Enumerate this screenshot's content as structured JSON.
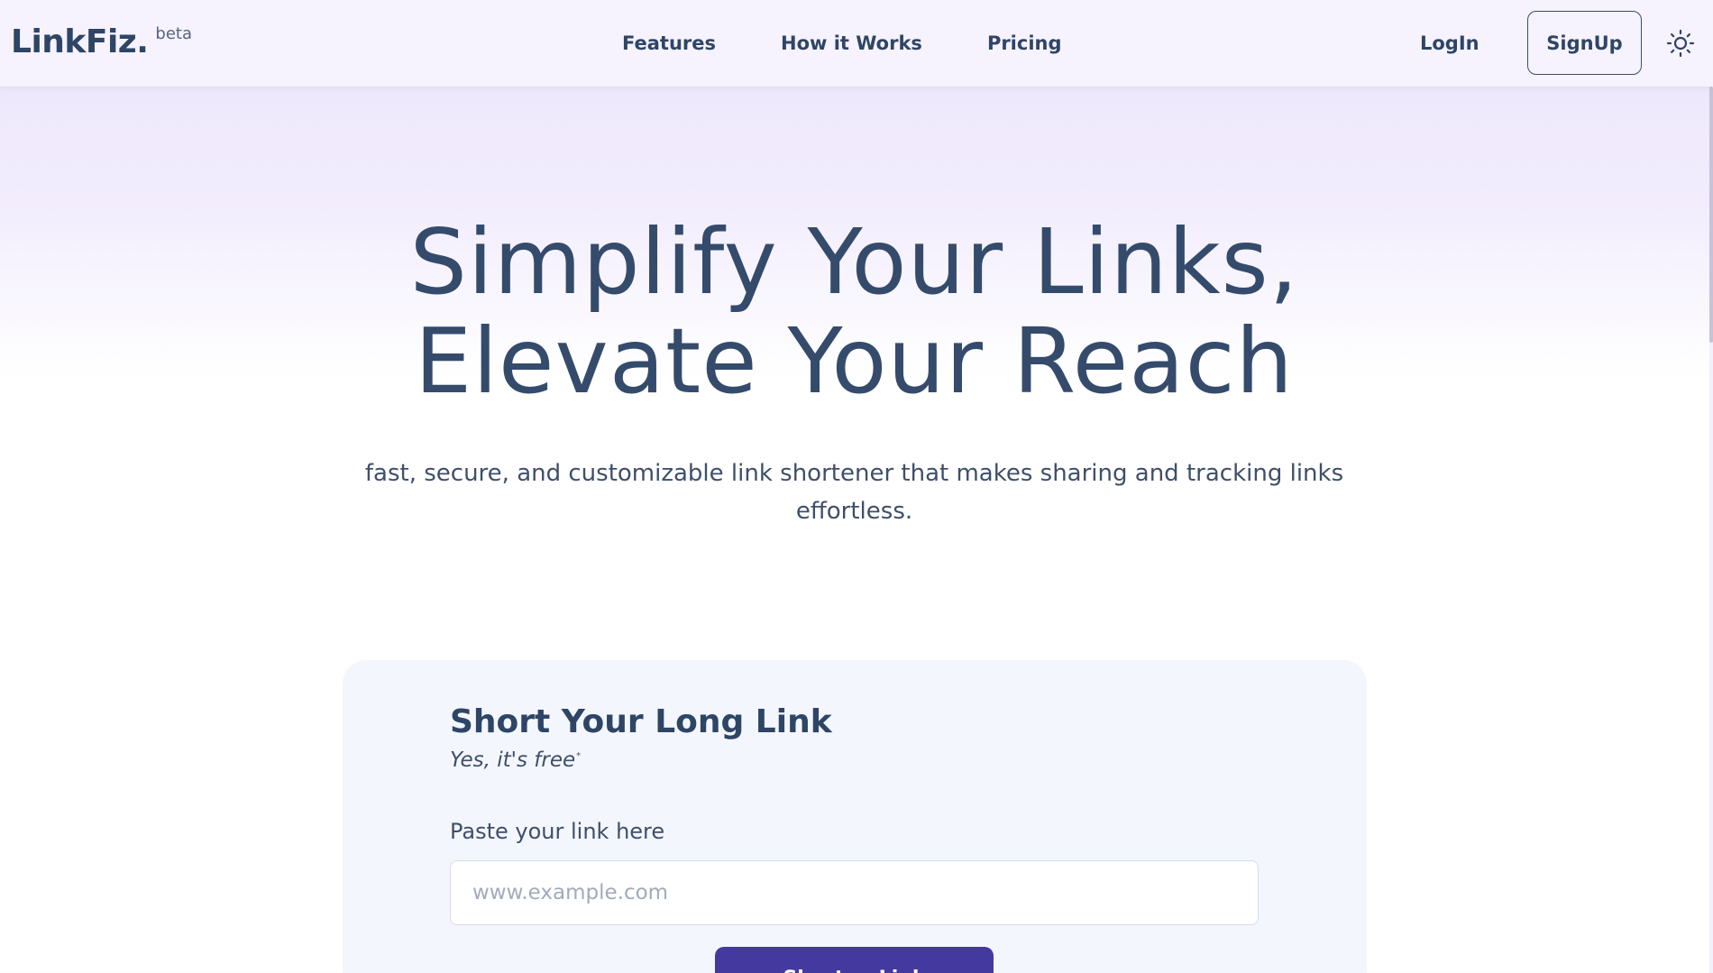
{
  "header": {
    "brand": "LinkFiz.",
    "brand_tag": "beta",
    "nav": [
      "Features",
      "How it Works",
      "Pricing"
    ],
    "login_label": "LogIn",
    "signup_label": "SignUp",
    "theme_icon": "sun-icon"
  },
  "hero": {
    "title_line1": "Simplify Your Links,",
    "title_line2": "Elevate Your Reach",
    "subtitle": "fast, secure, and customizable link shortener that makes sharing and tracking links effortless."
  },
  "shortener": {
    "title": "Short Your Long Link",
    "subtitle": "Yes, it's free",
    "subtitle_mark": "*",
    "field_label": "Paste your link here",
    "input_placeholder": "www.example.com",
    "input_value": "",
    "button_label": "Shorten Link"
  },
  "colors": {
    "brand_text": "#2e4566",
    "primary_button": "#44399e",
    "card_background": "#f3f6fd",
    "header_background": "#f6f2fe"
  }
}
